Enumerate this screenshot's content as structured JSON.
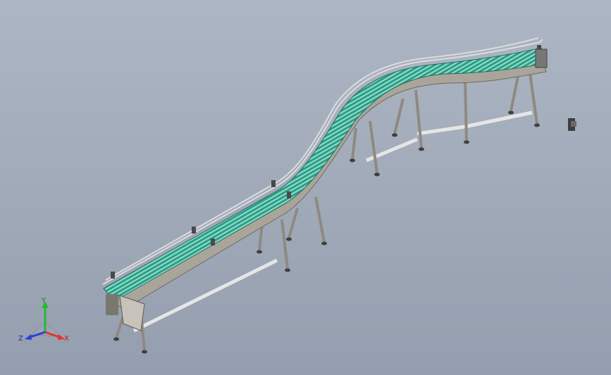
{
  "viewport": {
    "background_top": "#adb6c4",
    "background_bottom": "#949eae"
  },
  "model": {
    "belt_color": "#2f9c85",
    "belt_slat_color": "#8fe0cc",
    "frame_color": "#aaa59a",
    "frame_dark": "#6e6b63",
    "guard_rail_color": "#d8d8d8"
  },
  "triad": {
    "x_label": "X",
    "y_label": "Y",
    "z_label": "Z",
    "x_color": "#e8312a",
    "y_color": "#28b834",
    "z_color": "#2a3fd8"
  }
}
